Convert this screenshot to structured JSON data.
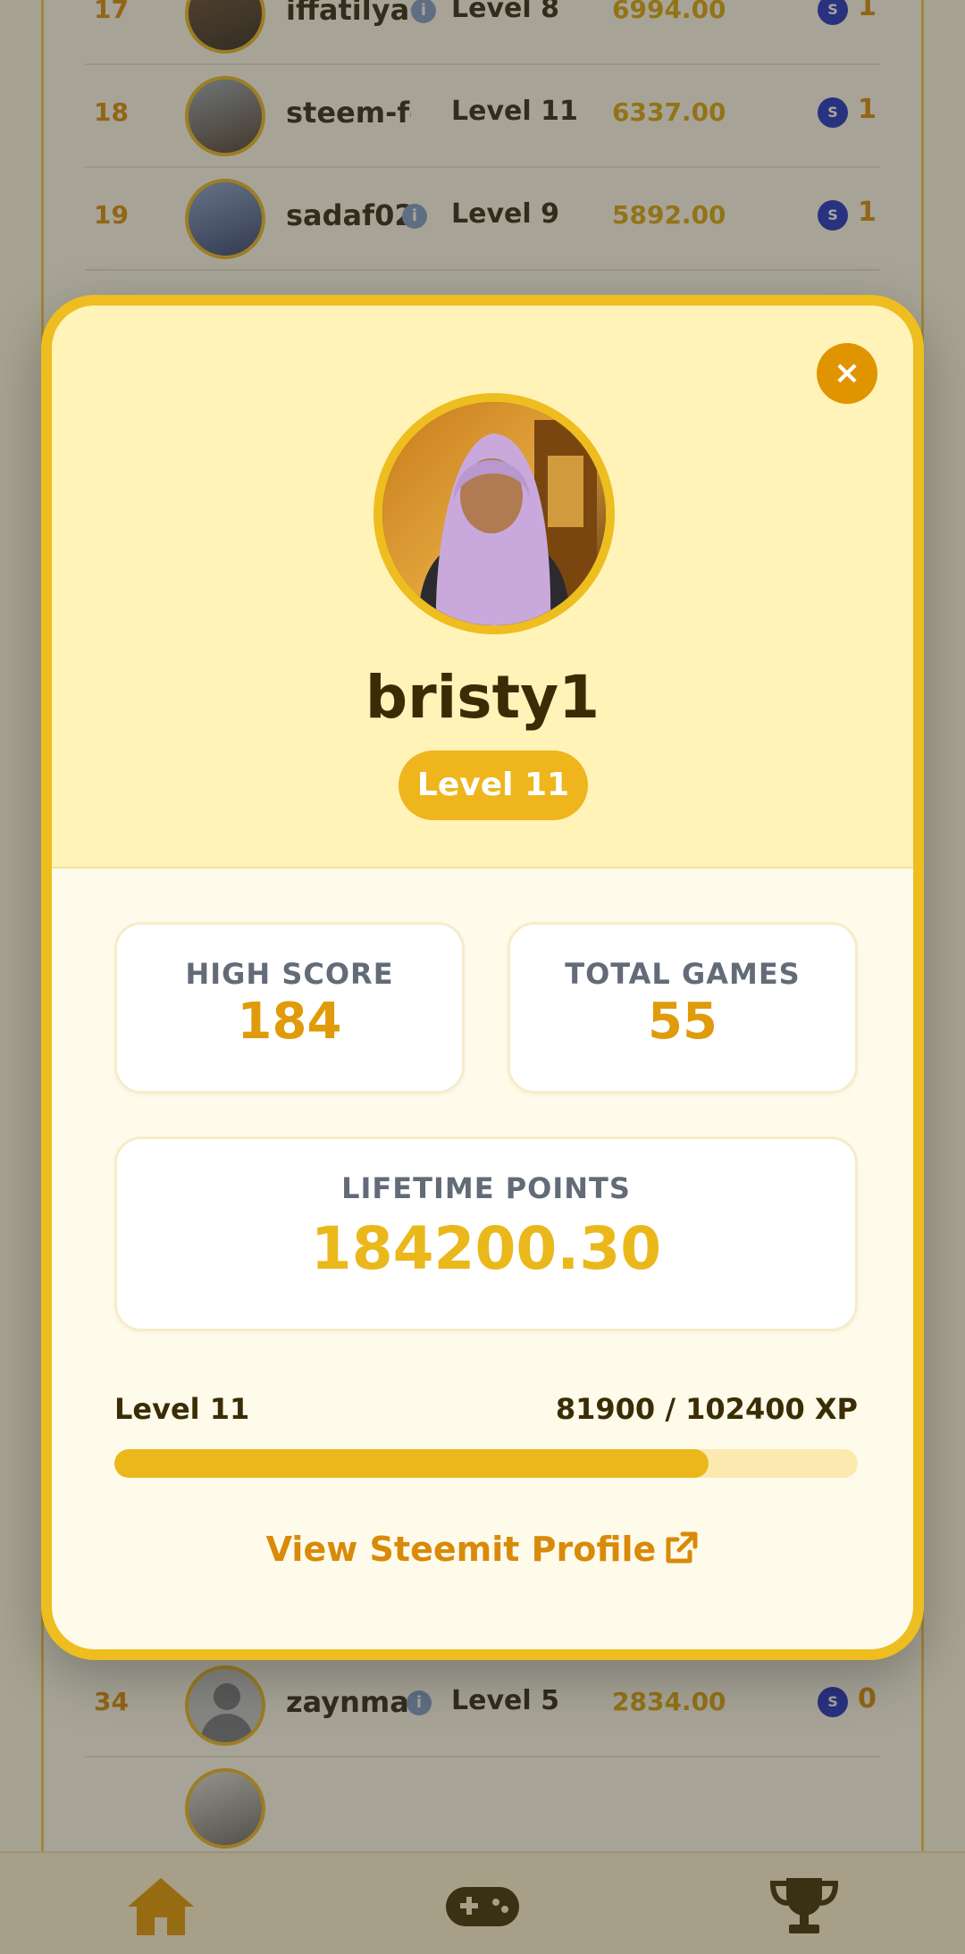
{
  "leaderboard": {
    "rows_top": [
      {
        "rank": "17",
        "name": "iffatilyas",
        "level": "Level 8",
        "points": "6994.00",
        "count": "1"
      },
      {
        "rank": "18",
        "name": "steem-for-",
        "level": "Level 11",
        "points": "6337.00",
        "count": "1"
      },
      {
        "rank": "19",
        "name": "sadaf02",
        "level": "Level 9",
        "points": "5892.00",
        "count": "1"
      }
    ],
    "rows_bottom": [
      {
        "rank": "34",
        "name": "zaynma",
        "level": "Level 5",
        "points": "2834.00",
        "count": "0"
      }
    ],
    "info_glyph": "i",
    "coin_glyph": "S"
  },
  "nav": {
    "items": [
      {
        "icon": "home-icon",
        "active": true
      },
      {
        "icon": "gamepad-icon",
        "active": false
      },
      {
        "icon": "trophy-icon",
        "active": false
      }
    ]
  },
  "modal": {
    "close_label": "×",
    "username": "bristy1",
    "level_badge": "Level 11",
    "stats": {
      "high_score_label": "HIGH SCORE",
      "high_score_value": "184",
      "total_games_label": "TOTAL GAMES",
      "total_games_value": "55",
      "lifetime_label": "LIFETIME POINTS",
      "lifetime_value": "184200.30"
    },
    "xp": {
      "level_label": "Level 11",
      "progress_text": "81900 / 102400 XP",
      "current": 81900,
      "max": 102400
    },
    "profile_link": "View Steemit Profile"
  },
  "colors": {
    "accent": "#eebd1f",
    "orange": "#e09500",
    "text_dark": "#3a2c05"
  }
}
